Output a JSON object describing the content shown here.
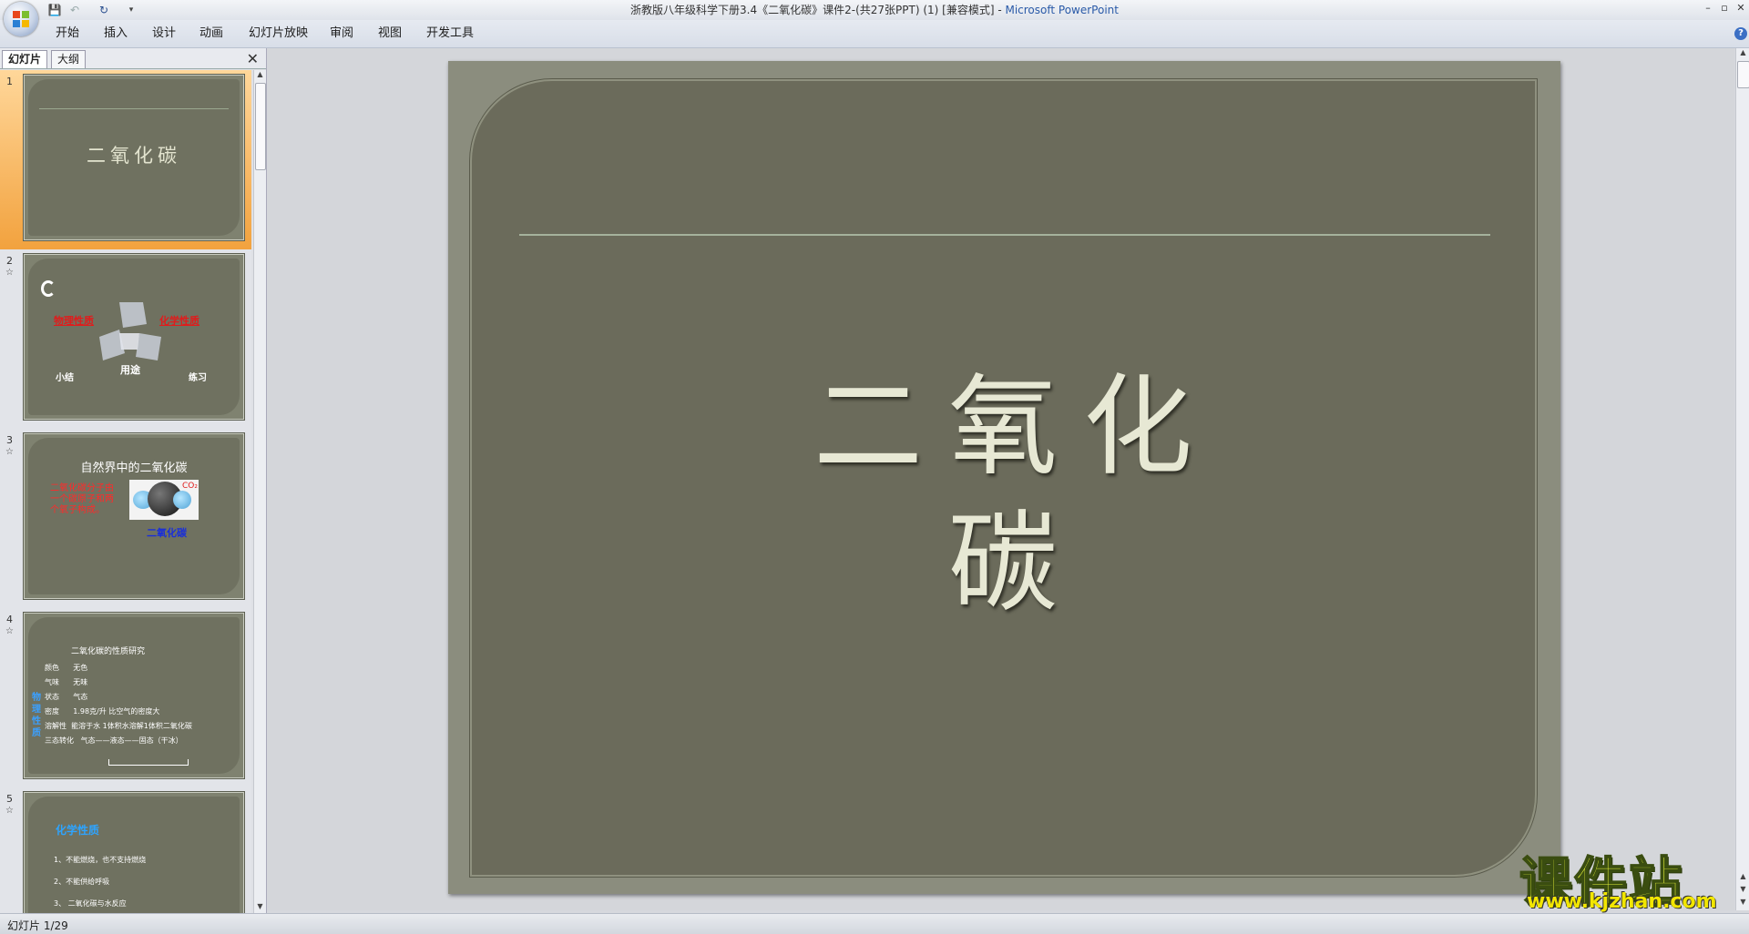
{
  "window": {
    "title_doc": "浙教版八年级科学下册3.4《二氧化碳》课件2-(共27张PPT) (1) [兼容模式] - ",
    "title_app": "Microsoft PowerPoint",
    "minimize": "–",
    "restore": "▫",
    "close": "✕"
  },
  "quick_access": {
    "save": "💾",
    "undo": "↶",
    "redo": "↻",
    "customize": "▾"
  },
  "ribbon": {
    "tabs": [
      "开始",
      "插入",
      "设计",
      "动画",
      "幻灯片放映",
      "审阅",
      "视图",
      "开发工具"
    ],
    "help": "?"
  },
  "left_pane": {
    "tabs": [
      "幻灯片",
      "大纲"
    ],
    "close": "✕",
    "star": "☆",
    "slides": [
      {
        "num": "1",
        "title": "二氧化碳"
      },
      {
        "num": "2",
        "labels": [
          "物理性质",
          "化学性质",
          "用途",
          "小结",
          "练习"
        ]
      },
      {
        "num": "3",
        "title": "自然界中的二氧化碳",
        "text": "二氧化碳分子由一个碳原子和两个氧子构成。",
        "caption": "二氧化碳",
        "formula": "CO₂"
      },
      {
        "num": "4",
        "title": "二氧化碳的性质研究",
        "side": "物理性质",
        "rows": [
          [
            "颜色",
            "无色"
          ],
          [
            "气味",
            "无味"
          ],
          [
            "状态",
            "气态"
          ],
          [
            "密度",
            "1.98克/升    比空气的密度大"
          ],
          [
            "溶解性",
            "能溶于水    1体积水溶解1体积二氧化碳"
          ],
          [
            "三态转化",
            "气态——液态——固态（干冰）"
          ]
        ]
      },
      {
        "num": "5",
        "title": "化学性质",
        "items": [
          "1、不能燃烧，也不支持燃烧",
          "2、不能供给呼吸",
          "3、 二氧化碳与水反应"
        ]
      }
    ]
  },
  "slide": {
    "title": "二氧化碳"
  },
  "status": {
    "text": "幻灯片 1/29"
  },
  "watermark": {
    "big": "课件站",
    "url": "www.kjzhan.com"
  }
}
